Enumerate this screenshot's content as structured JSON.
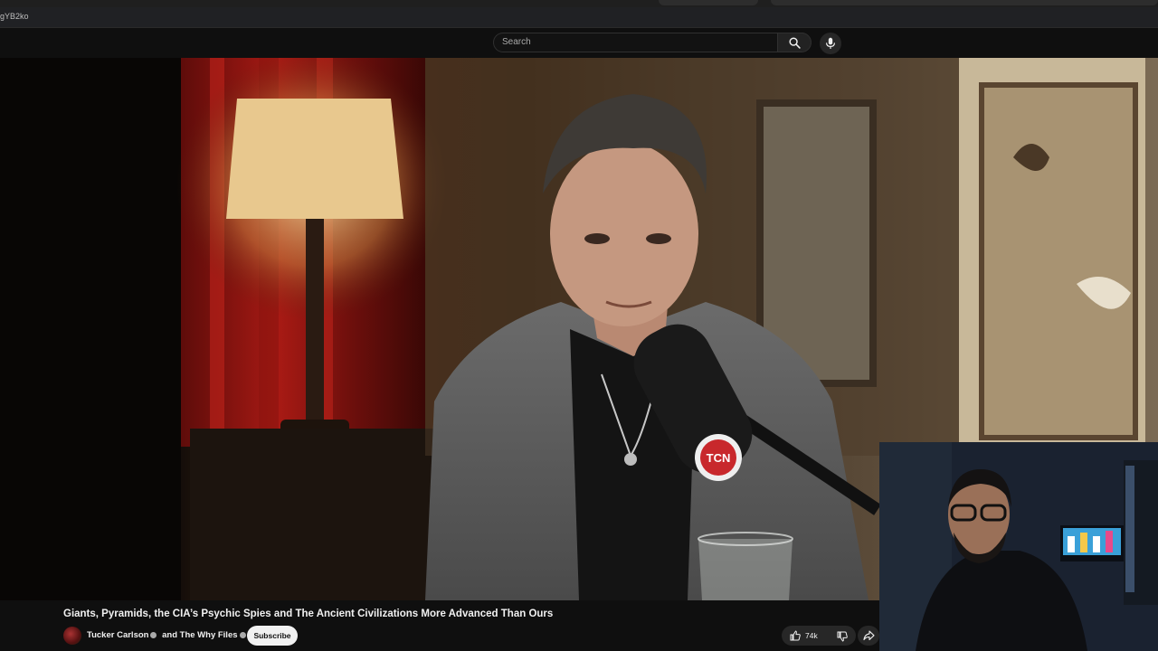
{
  "browser": {
    "url_fragment": "gYB2ko"
  },
  "masthead": {
    "search_placeholder": "Search",
    "search_icon": "search-icon",
    "mic_icon": "microphone-icon"
  },
  "video": {
    "microphone_logo_text": "TCN"
  },
  "watch": {
    "title": "Giants, Pyramids, the CIA’s Psychic Spies and The Ancient Civilizations More Advanced Than Ours",
    "channel_1": "Tucker Carlson",
    "connector": "and",
    "channel_2": "The Why Files",
    "subscribe_label": "Subscribe",
    "like_count": "74k",
    "like_icon": "thumbs-up-icon",
    "dislike_icon": "thumbs-down-icon",
    "share_icon": "share-icon"
  },
  "colors": {
    "background": "#0f0f0f",
    "subscribe_bg": "#f1f1f1",
    "chip_bg": "#272727"
  }
}
